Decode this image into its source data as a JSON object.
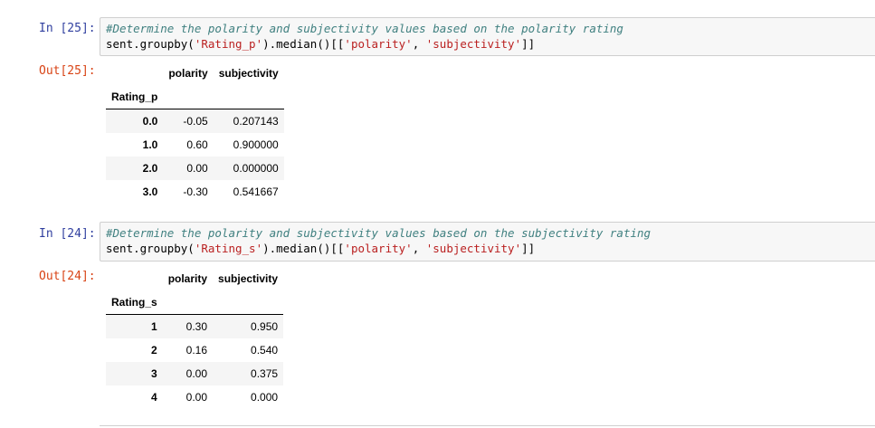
{
  "cells": [
    {
      "in_prompt": "In [25]:",
      "out_prompt": "Out[25]:",
      "code_line1": "#Determine the polarity and subjectivity values based on the polarity rating",
      "code_line2": {
        "a": "sent.groupby(",
        "s1": "'Rating_p'",
        "b": ").median()[[",
        "s2": "'polarity'",
        "c": ", ",
        "s3": "'subjectivity'",
        "d": "]]"
      },
      "table": {
        "columns": [
          "polarity",
          "subjectivity"
        ],
        "index_name": "Rating_p",
        "rows": [
          {
            "index": "0.0",
            "polarity": "-0.05",
            "subjectivity": "0.207143"
          },
          {
            "index": "1.0",
            "polarity": "0.60",
            "subjectivity": "0.900000"
          },
          {
            "index": "2.0",
            "polarity": "0.00",
            "subjectivity": "0.000000"
          },
          {
            "index": "3.0",
            "polarity": "-0.30",
            "subjectivity": "0.541667"
          }
        ]
      }
    },
    {
      "in_prompt": "In [24]:",
      "out_prompt": "Out[24]:",
      "code_line1": "#Determine the polarity and subjectivity values based on the subjectivity rating",
      "code_line2": {
        "a": "sent.groupby(",
        "s1": "'Rating_s'",
        "b": ").median()[[",
        "s2": "'polarity'",
        "c": ", ",
        "s3": "'subjectivity'",
        "d": "]]"
      },
      "table": {
        "columns": [
          "polarity",
          "subjectivity"
        ],
        "index_name": "Rating_s",
        "rows": [
          {
            "index": "1",
            "polarity": "0.30",
            "subjectivity": "0.950"
          },
          {
            "index": "2",
            "polarity": "0.16",
            "subjectivity": "0.540"
          },
          {
            "index": "3",
            "polarity": "0.00",
            "subjectivity": "0.375"
          },
          {
            "index": "4",
            "polarity": "0.00",
            "subjectivity": "0.000"
          }
        ]
      }
    }
  ]
}
